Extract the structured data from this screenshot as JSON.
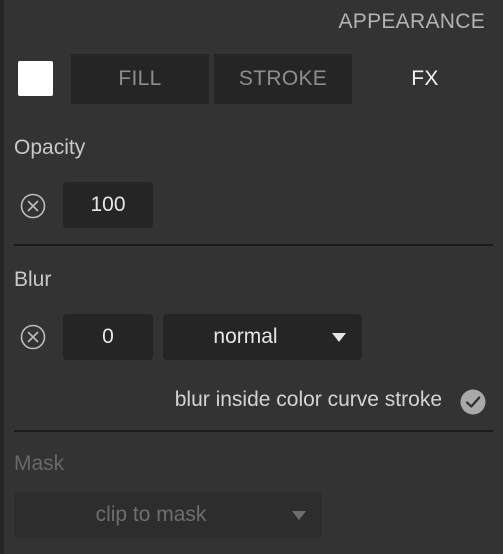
{
  "panel": {
    "title": "APPEARANCE",
    "swatch_color": "#ffffff"
  },
  "tabs": [
    {
      "label": "FILL",
      "active": false
    },
    {
      "label": "STROKE",
      "active": false
    },
    {
      "label": "FX",
      "active": true
    }
  ],
  "opacity": {
    "label": "Opacity",
    "value": "100",
    "clear_icon": "circle-x-icon"
  },
  "blur": {
    "label": "Blur",
    "value": "0",
    "mode": "normal",
    "clear_icon": "circle-x-icon",
    "inside_label": "blur inside color curve stroke",
    "inside_checked": true
  },
  "mask": {
    "label": "Mask",
    "mode": "clip to mask",
    "enabled": false
  },
  "colors": {
    "panel_bg": "#333333",
    "field_bg": "#252525",
    "text": "#e6e6e6",
    "muted": "#8e8e8e"
  }
}
